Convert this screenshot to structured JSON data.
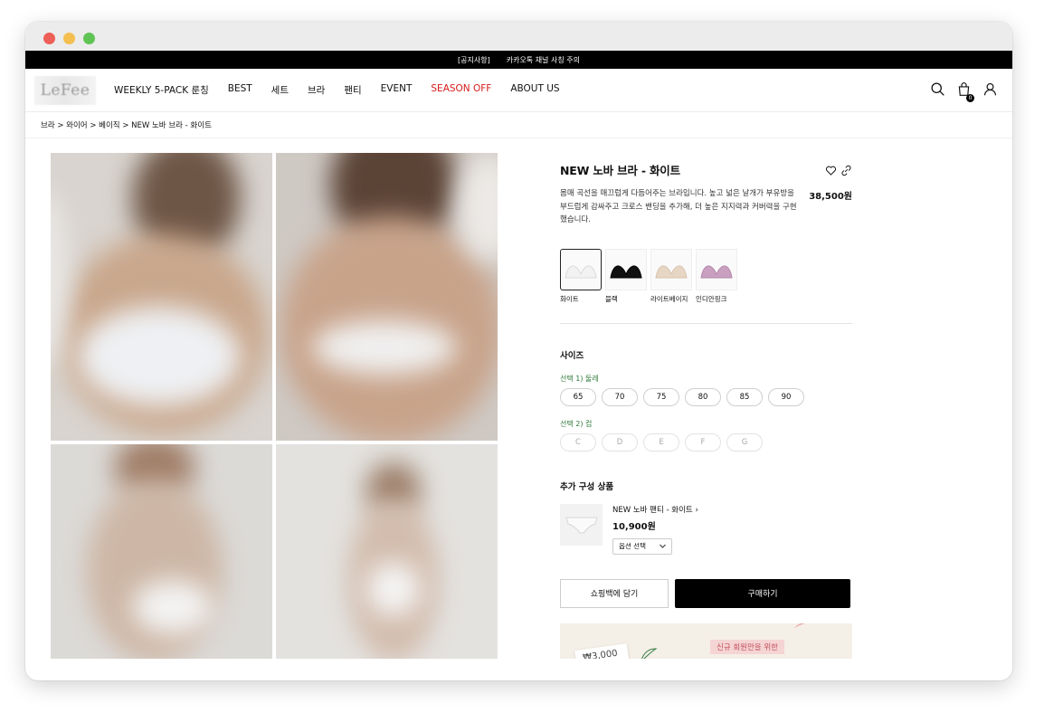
{
  "notice": {
    "left": "[공지사항]",
    "right": "카카오톡 채널 사칭 주의"
  },
  "nav": {
    "logo": "LeFee",
    "menu": [
      "WEEKLY 5-PACK 룬칭",
      "BEST",
      "세트",
      "브라",
      "팬티",
      "EVENT",
      "SEASON OFF",
      "ABOUT US"
    ],
    "sale_color": "#d71a1a",
    "cart_count": "0"
  },
  "breadcrumb": "브라 > 와이어 > 베이직 > NEW 노바 브라 - 화이트",
  "product": {
    "title": "NEW 노바 브라 - 화이트",
    "description": "몸매 곡선을 매끄럽게 다듬어주는 브라입니다. 높고 넓은 날개가 부유방을 부드럽게 감싸주고 크로스 밴딩을 추가해, 더 높은 지지력과 커버력을 구현했습니다.",
    "price": "38,500원",
    "colors": [
      {
        "label": "화이트",
        "color": "#f2f2f2",
        "selected": true
      },
      {
        "label": "블랙",
        "color": "#111111",
        "selected": false
      },
      {
        "label": "라이트베이지",
        "color": "#e8d6c4",
        "selected": false
      },
      {
        "label": "인디안핑크",
        "color": "#c9a0c0",
        "selected": false
      }
    ]
  },
  "size": {
    "title": "사이즈",
    "band_label": "선택 1) 둘레",
    "bands": [
      "65",
      "70",
      "75",
      "80",
      "85",
      "90"
    ],
    "cup_label": "선택 2) 컵",
    "cups": [
      "C",
      "D",
      "E",
      "F",
      "G"
    ]
  },
  "addon": {
    "title": "추가 구성 상품",
    "name": "NEW 노바 팬티 - 화이트",
    "price": "10,900원",
    "select_placeholder": "옵션 선택"
  },
  "buttons": {
    "cart": "쇼핑백에 담기",
    "buy": "구매하기"
  },
  "banner": {
    "tag": "신규 회원만을 위한",
    "coupon": "₩3,000"
  }
}
